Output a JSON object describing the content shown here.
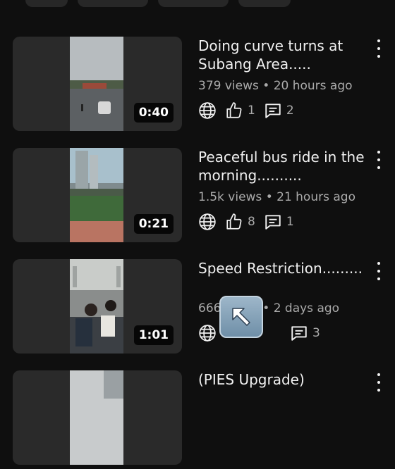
{
  "videos": [
    {
      "title": "Doing curve turns at Subang Area.....",
      "meta": "379 views • 20 hours ago",
      "duration": "0:40",
      "likes": "1",
      "comments": "2"
    },
    {
      "title": "Peaceful bus ride in the morning..........",
      "meta": "1.5k views • 21 hours ago",
      "duration": "0:21",
      "likes": "8",
      "comments": "1"
    },
    {
      "title": "Speed Restriction.........",
      "meta": "666 views • 2 days ago",
      "duration": "1:01",
      "likes": "",
      "comments": "3"
    },
    {
      "title": "(PIES Upgrade)",
      "meta": "",
      "duration": "",
      "likes": "",
      "comments": ""
    }
  ],
  "icons": {
    "visibility": "globe-icon",
    "like": "thumbs-up-icon",
    "comment": "comment-icon",
    "menu": "more-vert-icon",
    "overlay": "arrow-up-left-emoji-icon"
  },
  "colors": {
    "background": "#0f0f0f",
    "text_primary": "#f1f1f1",
    "text_secondary": "#aaaaaa",
    "thumb_bg": "#2a2a2a"
  }
}
